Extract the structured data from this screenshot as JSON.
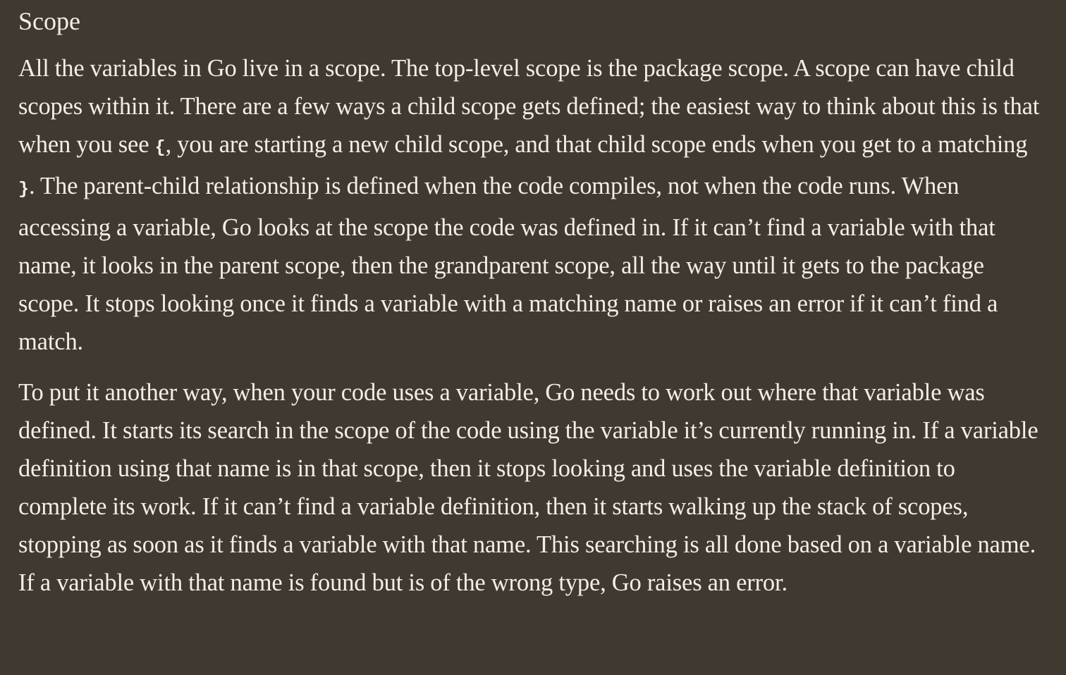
{
  "section": {
    "title": "Scope"
  },
  "paragraph1": {
    "part1": "All the variables in Go live in a scope. The top-level scope is the package scope. A scope can have child scopes within it. There are a few ways a child scope gets defined; the easiest way to think about this is that when you see ",
    "open_brace": "{",
    "part2": ", you are starting a new child scope, and that child scope ends when you get to a matching ",
    "close_brace": "}",
    "part3": ". The parent-child relationship is defined when the code compiles, not when the code runs. When accessing a variable, Go looks at the scope the code was defined in. If it can’t find a variable with that name, it looks in the parent scope, then the grandparent scope, all the way until it gets to the package scope. It stops looking once it finds a variable with a matching name or raises an error if it can’t find a match."
  },
  "paragraph2": {
    "text": "To put it another way, when your code uses a variable, Go needs to work out where that variable was defined. It starts its search in the scope of the code using the variable it’s currently running in. If a variable definition using that name is in that scope, then it stops looking and uses the variable definition to complete its work. If it can’t find a variable definition, then it starts walking up the stack of scopes, stopping as soon as it finds a variable with that name. This searching is all done based on a variable name. If a variable with that name is found but is of the wrong type, Go raises an error."
  }
}
